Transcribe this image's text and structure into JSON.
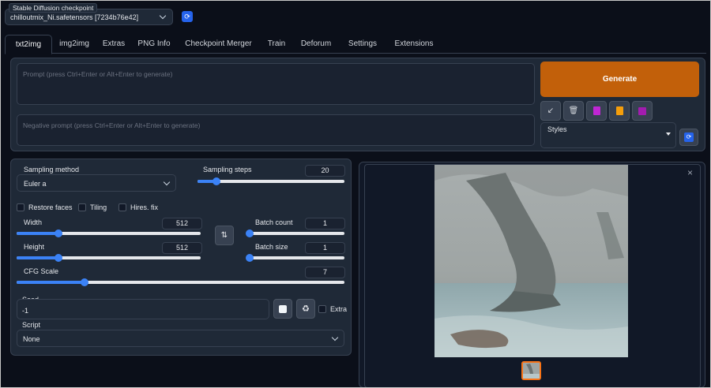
{
  "checkpoint": {
    "label": "Stable Diffusion checkpoint",
    "value": "chilloutmix_Ni.safetensors [7234b76e42]"
  },
  "tabs": [
    "txt2img",
    "img2img",
    "Extras",
    "PNG Info",
    "Checkpoint Merger",
    "Train",
    "Deforum",
    "Settings",
    "Extensions"
  ],
  "active_tab": "txt2img",
  "prompt": {
    "placeholder": "Prompt (press Ctrl+Enter or Alt+Enter to generate)"
  },
  "negative_prompt": {
    "placeholder": "Negative prompt (press Ctrl+Enter or Alt+Enter to generate)"
  },
  "generate_label": "Generate",
  "styles": {
    "label": "Styles",
    "value": ""
  },
  "sampling_method": {
    "label": "Sampling method",
    "value": "Euler a"
  },
  "sampling_steps": {
    "label": "Sampling steps",
    "value": "20",
    "min": 1,
    "max": 150
  },
  "checkboxes": {
    "restore_faces": "Restore faces",
    "tiling": "Tiling",
    "hires_fix": "Hires. fix"
  },
  "width": {
    "label": "Width",
    "value": "512",
    "min": 64,
    "max": 2048
  },
  "height": {
    "label": "Height",
    "value": "512",
    "min": 64,
    "max": 2048
  },
  "batch_count": {
    "label": "Batch count",
    "value": "1",
    "min": 1,
    "max": 100
  },
  "batch_size": {
    "label": "Batch size",
    "value": "1",
    "min": 1,
    "max": 8
  },
  "cfg_scale": {
    "label": "CFG Scale",
    "value": "7",
    "min": 1,
    "max": 30
  },
  "seed": {
    "label": "Seed",
    "value": "-1",
    "extra_label": "Extra"
  },
  "script": {
    "label": "Script",
    "value": "None"
  },
  "icons": {
    "swap": "swap-icon",
    "refresh": "refresh-icon",
    "dice": "dice-icon",
    "recycle": "recycle-icon",
    "close": "close-icon",
    "arrow": "arrow-icon",
    "trash": "trash-icon",
    "card": "card-icon",
    "clipboard": "clipboard-icon",
    "save": "save-icon"
  },
  "colors": {
    "accent": "#c2600a",
    "slider": "#3b82f6",
    "background": "#0b0f19",
    "panel": "#1f2937"
  }
}
